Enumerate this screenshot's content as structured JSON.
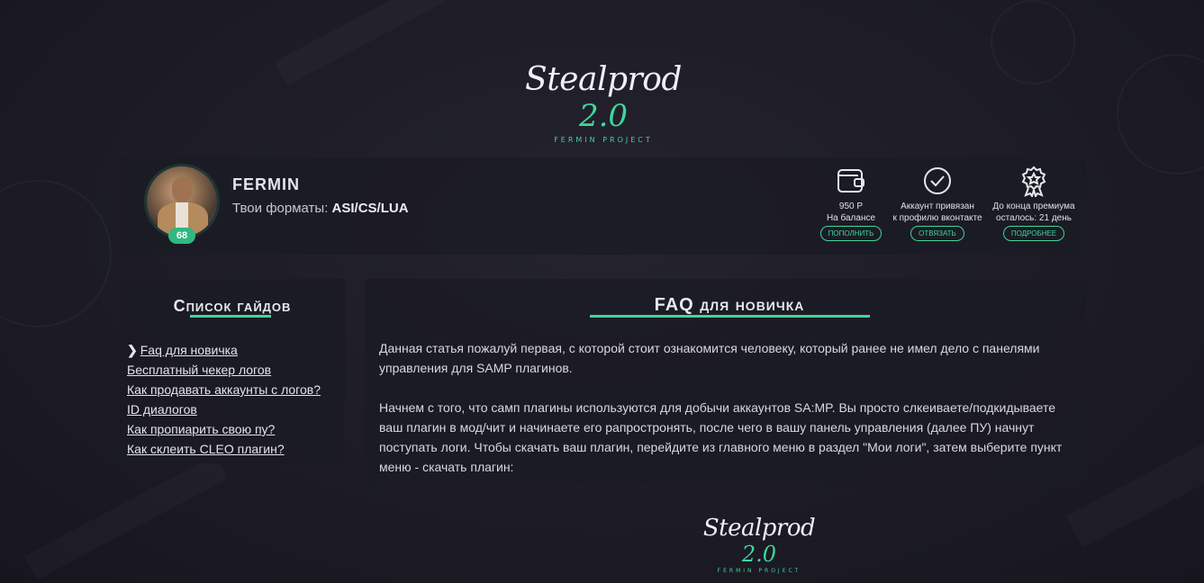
{
  "logo": {
    "word": "Stealprod",
    "version": "2.0",
    "subtitle": "FERMIN PROJECT"
  },
  "profile": {
    "username": "FERMIN",
    "formats_label": "Твои форматы:",
    "formats_value": "ASI/CS/LUA",
    "level": "68"
  },
  "stats": [
    {
      "icon": "wallet-icon",
      "line1": "950 Р",
      "line2": "На балансе",
      "button": "ПОПОЛНИТЬ"
    },
    {
      "icon": "check-circle-icon",
      "line1": "Аккаунт привязан",
      "line2": "к профилю вконтакте",
      "button": "ОТВЯЗАТЬ"
    },
    {
      "icon": "award-badge-icon",
      "line1": "До конца премиума",
      "line2": "осталось: 21 день",
      "button": "ПОДРОБНЕЕ"
    }
  ],
  "guides": {
    "title": "Список гайдов",
    "items": [
      "Faq для новичка",
      "Бесплатный чекер логов",
      "Как продавать аккаунты с логов?",
      "ID диалогов",
      "Как пропиарить свою пу?",
      "Как склеить CLEO плагин?"
    ]
  },
  "article": {
    "title": "FAQ для новичка",
    "paragraphs": [
      "Данная статья пожалуй первая, с которой стоит ознакомится человеку, который ранее не имел дело с панелями управления для SAMP плагинов.",
      "Начнем с того, что самп плагины используются для добычи аккаунтов SA:MP. Вы просто слкеиваете/подкидываете ваш плагин в мод/чит и начинаете его рапростронять, после чего в вашу панель управления (далее ПУ) начнут поступать логи. Чтобы скачать ваш плагин, перейдите из главного меню в раздел \"Мои логи\", затем выберите пункт меню - скачать плагин:"
    ]
  },
  "colors": {
    "accent": "#3fd69a",
    "background": "#1d1c26",
    "panel": "#1b1b24"
  }
}
